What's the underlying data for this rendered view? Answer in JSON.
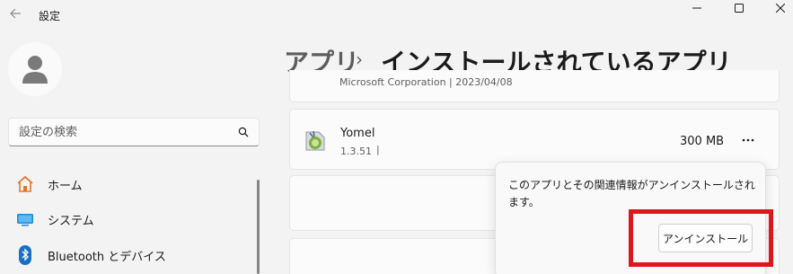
{
  "window": {
    "title": "設定"
  },
  "sidebar": {
    "search": {
      "placeholder": "設定の検索"
    },
    "items": [
      {
        "label": "ホーム"
      },
      {
        "label": "システム"
      },
      {
        "label": "Bluetooth とデバイス"
      }
    ]
  },
  "header": {
    "breadcrumb_parent": "アプリ",
    "breadcrumb_separator": "›",
    "breadcrumb_current": "インストールされているアプリ"
  },
  "app_list": {
    "previous_item_cut_text": "Microsoft Corporation  |  2023/04/08",
    "app": {
      "name": "Yomel",
      "version": "1.3.51",
      "separator": "|",
      "size": "300 MB"
    }
  },
  "flyout": {
    "message": "このアプリとその関連情報がアンインストールされます。",
    "button_label": "アンインストール"
  },
  "colors": {
    "highlight": "#e0161d",
    "background": "#f3f3f3",
    "card": "#fbfbfb"
  },
  "icons": [
    "back-arrow-icon",
    "minimize-icon",
    "maximize-icon",
    "close-icon",
    "user-avatar-icon",
    "search-icon",
    "home-icon",
    "system-display-icon",
    "bluetooth-icon",
    "app-icon",
    "more-options-icon"
  ]
}
